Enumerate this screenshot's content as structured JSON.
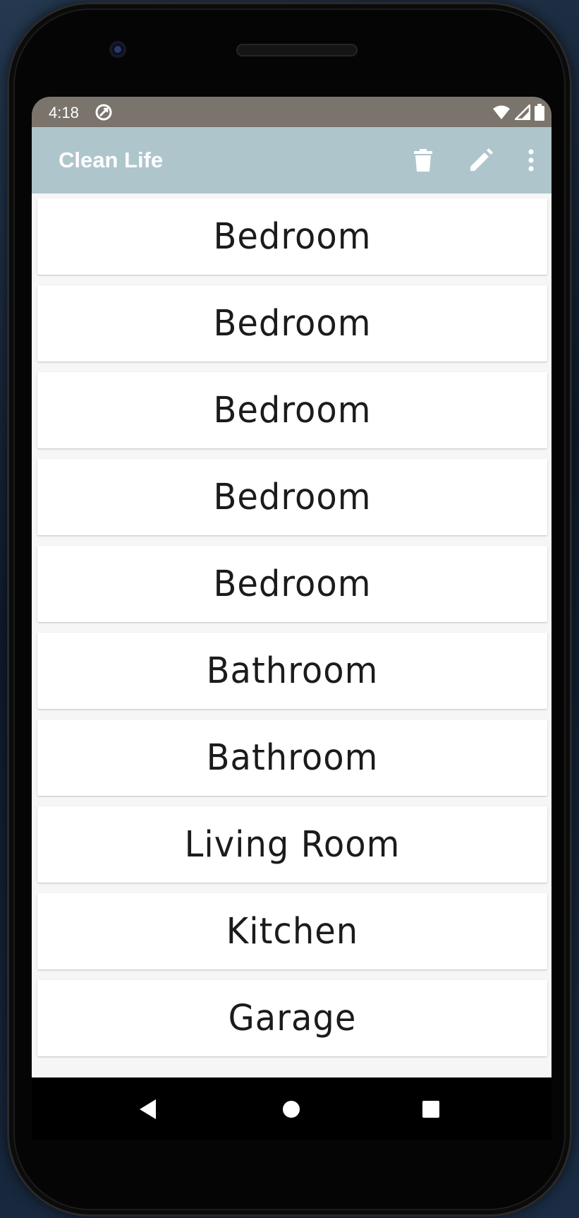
{
  "status_bar": {
    "time": "4:18",
    "icons": [
      "sync-icon",
      "wifi-icon",
      "signal-icon",
      "battery-icon"
    ]
  },
  "app_bar": {
    "title": "Clean Life",
    "actions": [
      "delete-icon",
      "edit-icon",
      "more-vert-icon"
    ]
  },
  "rooms": [
    "Bedroom",
    "Bedroom",
    "Bedroom",
    "Bedroom",
    "Bedroom",
    "Bathroom",
    "Bathroom",
    "Living Room",
    "Kitchen",
    "Garage"
  ],
  "nav_bar": {
    "buttons": [
      "back-icon",
      "home-icon",
      "recents-icon"
    ]
  },
  "colors": {
    "status_bar": "#7a746c",
    "app_bar": "#aec5cc",
    "list_background": "#f6f6f6",
    "card": "#ffffff"
  }
}
